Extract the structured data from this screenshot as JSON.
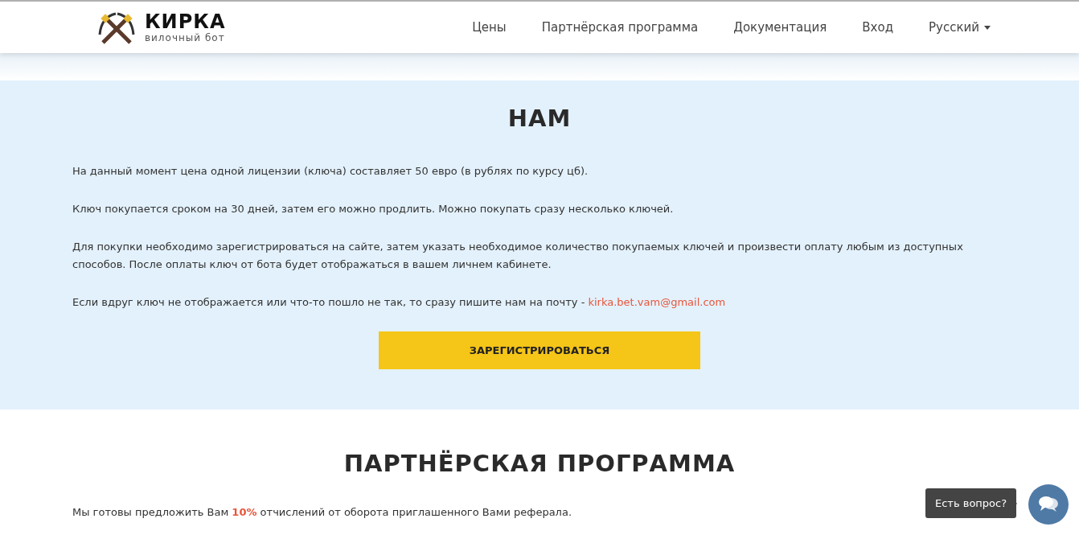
{
  "header": {
    "logo": {
      "title": "КИРКА",
      "subtitle": "вилочный бот"
    },
    "nav": [
      {
        "label": "Цены",
        "kind": "link"
      },
      {
        "label": "Партнёрская программа",
        "kind": "link"
      },
      {
        "label": "Документация",
        "kind": "link"
      },
      {
        "label": "Вход",
        "kind": "link"
      },
      {
        "label": "Русский",
        "kind": "dropdown"
      }
    ]
  },
  "prices": {
    "title": "НАМ",
    "paragraphs": [
      {
        "text": "На данный момент цена одной лицензии (ключа) составляет 50 евро (в рублях по курсу цб)."
      },
      {
        "text": "Ключ покупается сроком на 30 дней, затем его можно продлить. Можно покупать сразу несколько ключей."
      },
      {
        "text": "Для покупки необходимо зарегистрироваться на сайте, затем указать необходимое количество покупаемых ключей и произвести оплату любым из доступных способов. После оплаты ключ от бота будет отображаться в вашем личнем кабинете."
      },
      {
        "text": "Если вдруг ключ не отображается или что-то пошло не так, то сразу пишите нам на почту - ",
        "link": "kirka.bet.vam@gmail.com"
      }
    ],
    "button": "ЗАРЕГИСТРИРОВАТЬСЯ"
  },
  "partner": {
    "title": "ПАРТНЁРСКАЯ ПРОГРАММА",
    "text": "Мы готовы предложить Вам **10%** отчислений от оборота приглашенного Вами реферала."
  },
  "chat": {
    "tooltip": "Есть вопрос?"
  }
}
